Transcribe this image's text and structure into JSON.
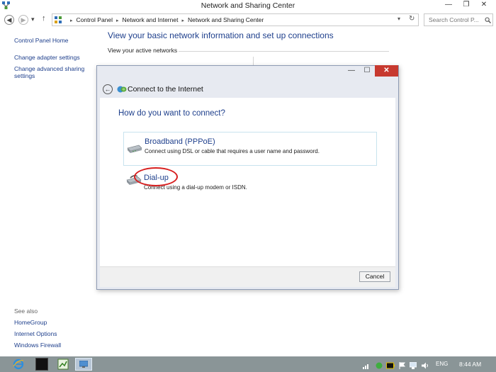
{
  "window": {
    "title": "Network and Sharing Center",
    "minimize_glyph": "—",
    "restore_glyph": "❐",
    "close_glyph": "✕"
  },
  "address_bar": {
    "back_glyph": "◀",
    "forward_glyph": "▶",
    "dropdown_glyph": "▾",
    "up_glyph": "↑",
    "breadcrumbs": [
      "Control Panel",
      "Network and Internet",
      "Network and Sharing Center"
    ],
    "separator": "▸",
    "refresh_glyph": "↻",
    "search_placeholder": "Search Control P..."
  },
  "left_pane": {
    "home": "Control Panel Home",
    "links": [
      "Change adapter settings",
      "Change advanced sharing settings"
    ],
    "see_also_label": "See also",
    "see_also": [
      "HomeGroup",
      "Internet Options",
      "Windows Firewall"
    ]
  },
  "main": {
    "heading": "View your basic network information and set up connections",
    "active_networks": "View your active networks"
  },
  "dialog": {
    "title": "Connect to the Internet",
    "back_glyph": "←",
    "question": "How do you want to connect?",
    "options": [
      {
        "title": "Broadband (PPPoE)",
        "desc": "Connect using DSL or cable that requires a user name and password."
      },
      {
        "title": "Dial-up",
        "desc": "Connect using a dial-up modem or ISDN."
      }
    ],
    "cancel": "Cancel",
    "minimize_glyph": "—",
    "maximize_glyph": "☐",
    "close_glyph": "✕"
  },
  "taskbar": {
    "language": "ENG",
    "time": "8:44 AM"
  },
  "icons": [
    "network-app-icon",
    "back-icon",
    "forward-icon",
    "up-icon",
    "refresh-icon",
    "search-icon",
    "globe-icon",
    "modem-icon",
    "ie-icon",
    "cmd-icon",
    "spreadsheet-icon",
    "control-panel-icon",
    "signal-icon",
    "action-center-icon",
    "battery-icon",
    "flag-icon",
    "volume-icon"
  ],
  "colors": {
    "link_blue": "#1e3f8c",
    "close_red": "#c7392f",
    "highlight_red": "#d71f1f",
    "taskbar": "#8a9597"
  }
}
